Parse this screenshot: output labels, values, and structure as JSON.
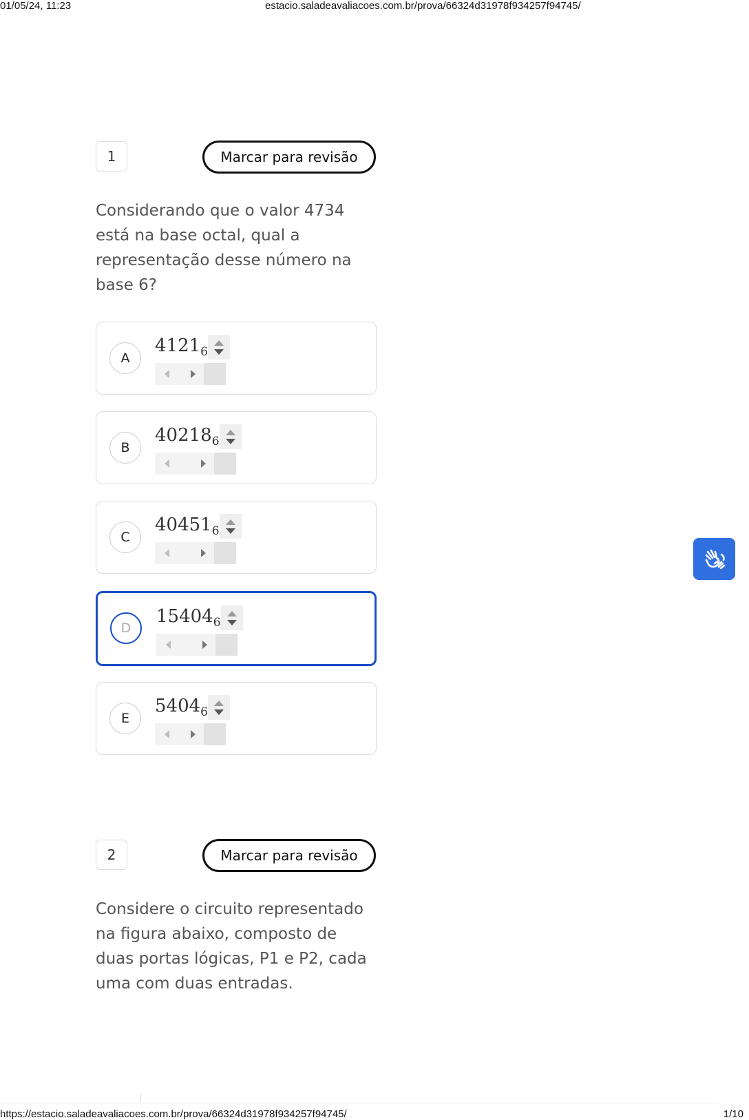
{
  "print_header": {
    "datetime": "01/05/24, 11:23",
    "url": "estacio.saladeavaliacoes.com.br/prova/66324d31978f934257f94745/"
  },
  "print_footer": {
    "url": "https://estacio.saladeavaliacoes.com.br/prova/66324d31978f934257f94745/",
    "page": "1/10"
  },
  "questions": [
    {
      "number": "1",
      "review_label": "Marcar para revisão",
      "text": "Considerando que o valor 4734 está na base octal, qual a representação desse número na base 6?",
      "options": [
        {
          "letter": "A",
          "value": "4121",
          "base": "6",
          "selected": false
        },
        {
          "letter": "B",
          "value": "40218",
          "base": "6",
          "selected": false
        },
        {
          "letter": "C",
          "value": "40451",
          "base": "6",
          "selected": false
        },
        {
          "letter": "D",
          "value": "15404",
          "base": "6",
          "selected": true
        },
        {
          "letter": "E",
          "value": "5404",
          "base": "6",
          "selected": false
        }
      ]
    },
    {
      "number": "2",
      "review_label": "Marcar para revisão",
      "text": "Considere o circuito representado na figura abaixo, composto de duas portas lógicas, P1 e P2, cada uma com duas entradas."
    }
  ],
  "accessibility_widget": {
    "icon": "sign-language-hands-icon",
    "color": "#2f6fe0"
  },
  "colors": {
    "selected_border": "#1a4fc4",
    "question_text": "#555555"
  }
}
